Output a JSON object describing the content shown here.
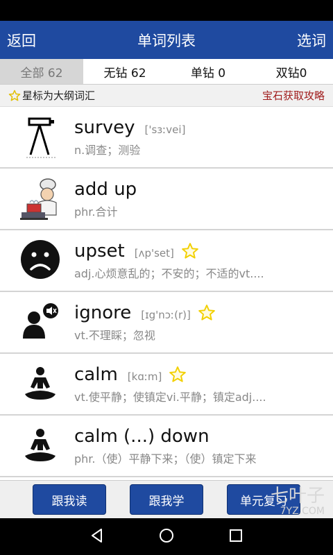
{
  "header": {
    "back_label": "返回",
    "title": "单词列表",
    "select_label": "选词"
  },
  "tabs": [
    {
      "label": "全部 62",
      "active": true
    },
    {
      "label": "无钻 62",
      "active": false
    },
    {
      "label": "单钻 0",
      "active": false
    },
    {
      "label": "双钻0",
      "active": false
    }
  ],
  "notice": {
    "star_text": "星标为大纲词汇",
    "link_text": "宝石获取攻略"
  },
  "words": [
    {
      "word": "survey",
      "phonetic": "['sɜːvei]",
      "definition": "n.调查；测验",
      "starred": false,
      "icon": "survey-tripod-icon"
    },
    {
      "word": "add up",
      "phonetic": "",
      "definition": "phr.合计",
      "starred": false,
      "icon": "chef-cooking-icon"
    },
    {
      "word": "upset",
      "phonetic": "[ʌp'set]",
      "definition": "adj.心烦意乱的；不安的；不适的vt....",
      "starred": true,
      "icon": "sad-face-icon"
    },
    {
      "word": "ignore",
      "phonetic": "[ɪg'nɔː(r)]",
      "definition": "vt.不理睬；忽视",
      "starred": true,
      "icon": "person-mute-icon"
    },
    {
      "word": "calm",
      "phonetic": "[kɑːm]",
      "definition": "vt.使平静；使镇定vi.平静；镇定adj....",
      "starred": true,
      "icon": "meditation-icon"
    },
    {
      "word": "calm (...) down",
      "phonetic": "",
      "definition": "phr.（使）平静下来；（使）镇定下来",
      "starred": false,
      "icon": "meditation-icon"
    }
  ],
  "bottom": {
    "read_label": "跟我读",
    "learn_label": "跟我学",
    "review_label": "单元复习"
  },
  "watermark": {
    "logo": "七叶子",
    "site": "7YZ.COM"
  },
  "colors": {
    "header": "#1f4aa0",
    "link": "#a01c1c",
    "star": "#f2d000"
  }
}
